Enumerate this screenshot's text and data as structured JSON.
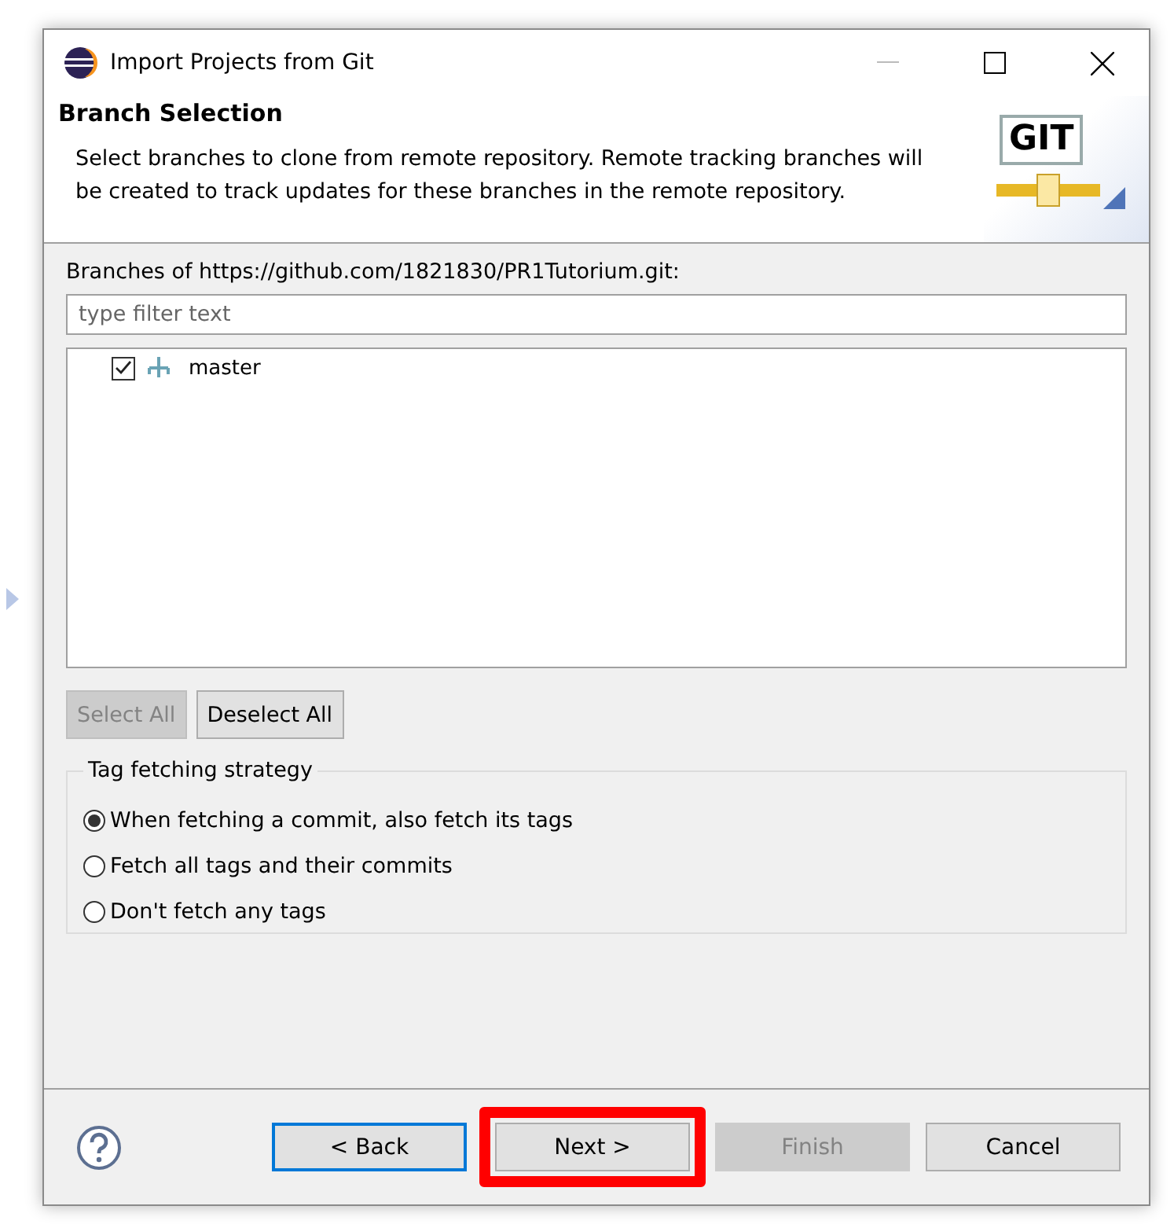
{
  "window": {
    "title": "Import Projects from Git"
  },
  "header": {
    "title": "Branch Selection",
    "description": "Select branches to clone from remote repository. Remote tracking branches will be created to track updates for these branches in the remote repository.",
    "logo_text": "GIT"
  },
  "branches_label": "Branches of https://github.com/1821830/PR1Tutorium.git:",
  "filter": {
    "placeholder": "type filter text"
  },
  "branches": [
    {
      "name": "master",
      "checked": true
    }
  ],
  "selection_buttons": [
    {
      "label": "Select All",
      "disabled": true
    },
    {
      "label": "Deselect All",
      "disabled": false
    }
  ],
  "tag_strategy": {
    "title": "Tag fetching strategy",
    "options": [
      {
        "label": "When fetching a commit, also fetch its tags",
        "selected": true
      },
      {
        "label": "Fetch all tags and their commits",
        "selected": false
      },
      {
        "label": "Don't fetch any tags",
        "selected": false
      }
    ]
  },
  "footer_buttons": [
    {
      "label": "< Back",
      "disabled": false,
      "focused": true,
      "highlighted": false
    },
    {
      "label": "Next >",
      "disabled": false,
      "focused": false,
      "highlighted": true
    },
    {
      "label": "Finish",
      "disabled": true,
      "focused": false,
      "highlighted": false
    },
    {
      "label": "Cancel",
      "disabled": false,
      "focused": false,
      "highlighted": false
    }
  ]
}
